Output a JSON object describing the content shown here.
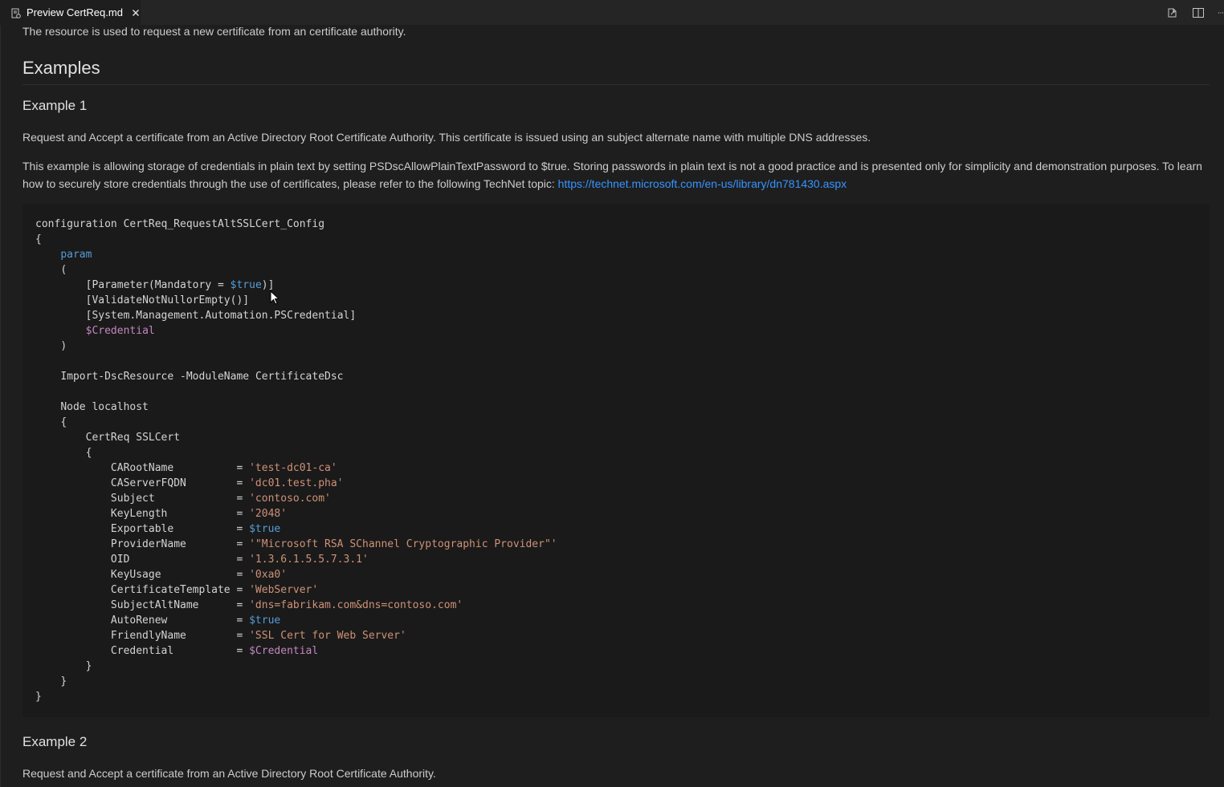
{
  "tab": {
    "label": "Preview CertReq.md",
    "icon": "preview-icon",
    "close_icon": "close-icon"
  },
  "toolbar": {
    "open_source_icon": "open-source-icon",
    "split_editor_icon": "split-editor-icon",
    "more_icon": "more-actions-icon"
  },
  "doc": {
    "intro": "The resource is used to request a new certificate from an certificate authority.",
    "examples_heading": "Examples",
    "example1": {
      "title": "Example 1",
      "p1": "Request and Accept a certificate from an Active Directory Root Certificate Authority. This certificate is issued using an subject alternate name with multiple DNS addresses.",
      "p2_text": "This example is allowing storage of credentials in plain text by setting PSDscAllowPlainTextPassword to $true. Storing passwords in plain text is not a good practice and is presented only for simplicity and demonstration purposes. To learn how to securely store credentials through the use of certificates, please refer to the following TechNet topic: ",
      "p2_link": "https://technet.microsoft.com/en-us/library/dn781430.aspx"
    },
    "code": {
      "l1": "configuration CertReq_RequestAltSSLCert_Config",
      "open_brace": "{",
      "close_brace": "}",
      "param": "param",
      "open_paren": "(",
      "close_paren": ")",
      "param_attr_a": "[Parameter(Mandatory = ",
      "param_attr_b": ")]",
      "true_kw": "$true",
      "validate": "[ValidateNotNullorEmpty()]",
      "pscred_type": "[System.Management.Automation.PSCredential]",
      "cred_var": "$Credential",
      "import": "Import-DscResource -ModuleName CertificateDsc",
      "node": "Node localhost",
      "certreq": "CertReq SSLCert",
      "props": [
        {
          "name": "CARootName          = ",
          "value": "'test-dc01-ca'",
          "type": "str"
        },
        {
          "name": "CAServerFQDN        = ",
          "value": "'dc01.test.pha'",
          "type": "str"
        },
        {
          "name": "Subject             = ",
          "value": "'contoso.com'",
          "type": "str"
        },
        {
          "name": "KeyLength           = ",
          "value": "'2048'",
          "type": "str"
        },
        {
          "name": "Exportable          = ",
          "value": "$true",
          "type": "kw"
        },
        {
          "name": "ProviderName        = ",
          "value": "'\"Microsoft RSA SChannel Cryptographic Provider\"'",
          "type": "str"
        },
        {
          "name": "OID                 = ",
          "value": "'1.3.6.1.5.5.7.3.1'",
          "type": "str"
        },
        {
          "name": "KeyUsage            = ",
          "value": "'0xa0'",
          "type": "str"
        },
        {
          "name": "CertificateTemplate = ",
          "value": "'WebServer'",
          "type": "str"
        },
        {
          "name": "SubjectAltName      = ",
          "value": "'dns=fabrikam.com&dns=contoso.com'",
          "type": "str"
        },
        {
          "name": "AutoRenew           = ",
          "value": "$true",
          "type": "kw"
        },
        {
          "name": "FriendlyName        = ",
          "value": "'SSL Cert for Web Server'",
          "type": "str"
        },
        {
          "name": "Credential          = ",
          "value": "$Credential",
          "type": "var"
        }
      ]
    },
    "example2": {
      "title": "Example 2",
      "p1": "Request and Accept a certificate from an Active Directory Root Certificate Authority."
    }
  },
  "colors": {
    "background": "#1e1e1e",
    "keyword": "#569cd6",
    "variable": "#c586c0",
    "string": "#ce9178",
    "link": "#3794ff"
  }
}
